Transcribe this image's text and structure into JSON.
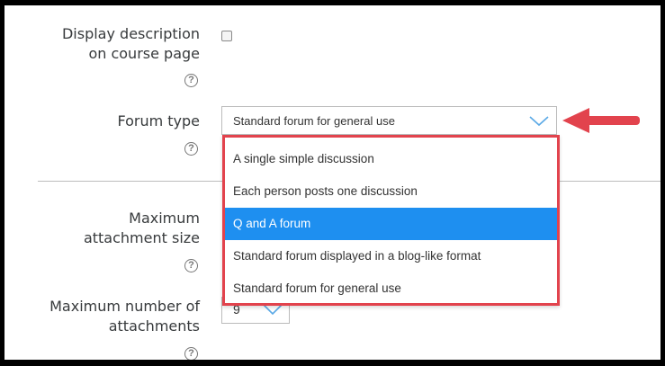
{
  "form": {
    "display_description": {
      "label_line1": "Display description",
      "label_line2": "on course page",
      "help": "?"
    },
    "forum_type": {
      "label": "Forum type",
      "help": "?",
      "selected_value": "Standard forum for general use",
      "options": [
        "A single simple discussion",
        "Each person posts one discussion",
        "Q and A forum",
        "Standard forum displayed in a blog-like format",
        "Standard forum for general use"
      ],
      "highlighted_option": "Q and A forum"
    },
    "max_attachment_size": {
      "label_line1": "Maximum",
      "label_line2": "attachment size",
      "help": "?"
    },
    "max_attachments": {
      "label_line1": "Maximum number of",
      "label_line2": "attachments",
      "value": "9",
      "help": "?"
    }
  },
  "colors": {
    "highlight": "#1e8ff0",
    "callout": "#e2434d",
    "chevron": "#5aa9e6"
  }
}
